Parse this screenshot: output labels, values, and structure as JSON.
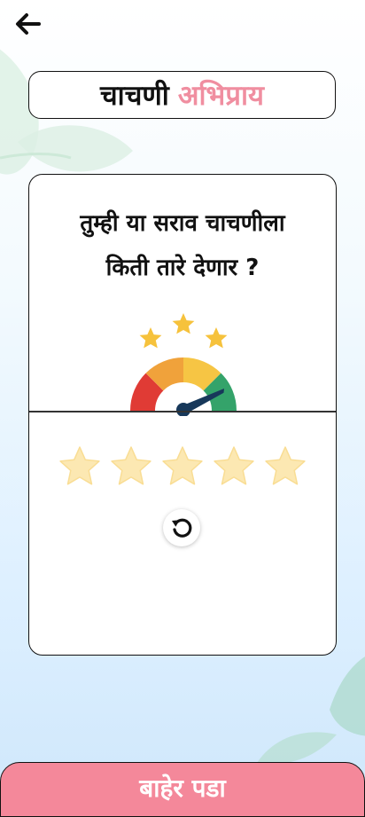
{
  "header": {
    "back_icon": "arrow-left-icon",
    "title_part1": "चाचणी",
    "title_part2": "अभिप्राय",
    "title_part2_color": "#f08ea0"
  },
  "card": {
    "question": "तुम्ही या सराव चाचणीला\nकिती तारे देणार ?",
    "gauge_icon": "rating-gauge-icon",
    "gauge_colors": [
      "#e03b35",
      "#f0a23b",
      "#f6c544",
      "#34a36a"
    ],
    "gauge_star_color": "#f6c23c",
    "rating": {
      "max": 5,
      "selected": 0,
      "star_color_empty": "#fce8b2"
    },
    "reset_icon": "reset-icon"
  },
  "footer": {
    "exit_label": "बाहेर पडा",
    "exit_color": "#f4889a"
  }
}
